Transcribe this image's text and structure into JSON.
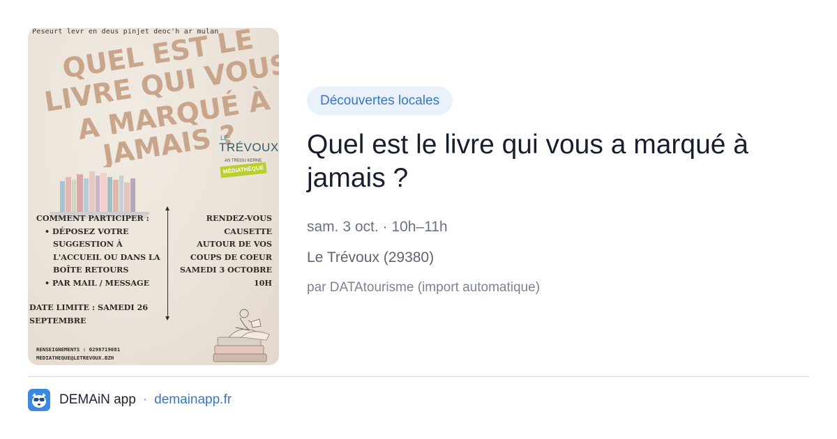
{
  "poster": {
    "top_line": "Peseurt levr en deus pinjet deoc'h ar mulan",
    "heading_lines": [
      "QUEL EST LE",
      "LIVRE QUI VOUS",
      "A MARQUÉ À",
      "JAMAIS ?"
    ],
    "logo": {
      "prefix": "LE",
      "name": "TRÉVOUX",
      "subtitle": "AN TREOU KERNE",
      "tag": "MÉDIATHÈQUE"
    },
    "left_column": [
      "COMMENT PARTICIPER :",
      "• DÉPOSEZ VOTRE",
      "SUGGESTION À",
      "L'ACCUEIL OU DANS LA",
      "BOÎTE RETOURS",
      "• PAR MAIL / MESSAGE"
    ],
    "right_column": [
      "RENDEZ-VOUS",
      "CAUSETTE",
      "AUTOUR DE VOS",
      "COUPS DE COEUR",
      "SAMEDI 3 OCTOBRE",
      "10H"
    ],
    "deadline": [
      "DATE LIMITE : SAMEDI 26",
      "SEPTEMBRE"
    ],
    "contact": [
      "RENSEIGNEMENTS : 0298719081",
      "MEDIATHEQUE@LETREVOUX.BZH"
    ]
  },
  "event": {
    "category": "Découvertes locales",
    "title": "Quel est le livre qui vous a marqué à jamais ?",
    "when": "sam. 3 oct. · 10h–11h",
    "where": "Le Trévoux (29380)",
    "source": "par DATAtourisme (import automatique)"
  },
  "footer": {
    "app_icon": "demain-app-icon",
    "app_name": "DEMAiN app",
    "separator": "·",
    "domain": "demainapp.fr"
  },
  "colors": {
    "accent": "#3776c4",
    "badge_bg": "#e9f1fb",
    "poster_heading": "#c9a68b",
    "app_icon_bg": "#3c8ae0"
  }
}
